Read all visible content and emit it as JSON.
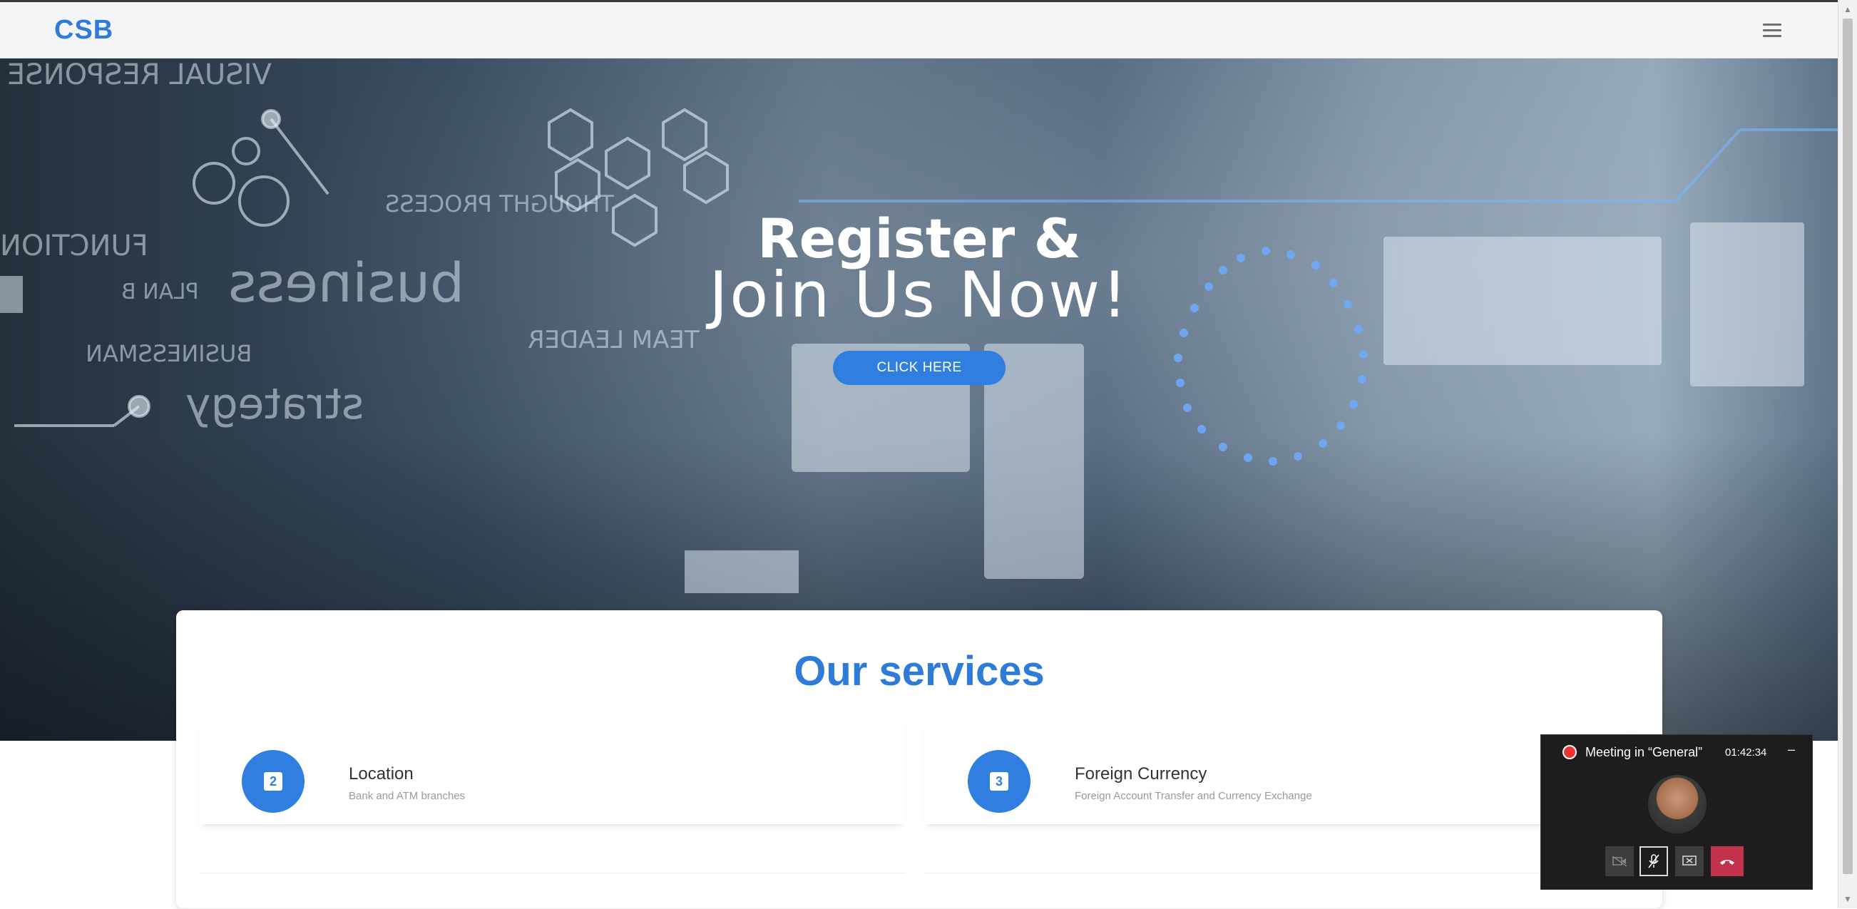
{
  "header": {
    "brand": "CSB",
    "menu_icon": "hamburger-menu-icon"
  },
  "hero": {
    "title": "Register &",
    "subtitle": "Join Us Now!",
    "cta_label": "CLICK HERE",
    "background_words": [
      "VISUAL RESPONSE",
      "FUNCTION",
      "business",
      "PLAN B",
      "BUSINESSMAN",
      "strategy",
      "THOUGHT PROCESS",
      "TEAM LEADER"
    ]
  },
  "services": {
    "title": "Our services",
    "cards": [
      {
        "number": "2",
        "title": "Location",
        "description": "Bank and ATM branches",
        "icon": "numbered-badge-icon"
      },
      {
        "number": "3",
        "title": "Foreign Currency",
        "description": "Foreign Account Transfer and Currency Exchange",
        "icon": "numbered-badge-icon"
      }
    ]
  },
  "meeting": {
    "title": "Meeting in “General”",
    "time": "01:42:34",
    "minimize": "–",
    "controls": [
      "camera-off-icon",
      "mic-muted-icon",
      "share-screen-icon",
      "hang-up-icon"
    ]
  },
  "colors": {
    "accent": "#2e7bd8",
    "button": "#2f7ee0",
    "hangup": "#c4314b"
  }
}
